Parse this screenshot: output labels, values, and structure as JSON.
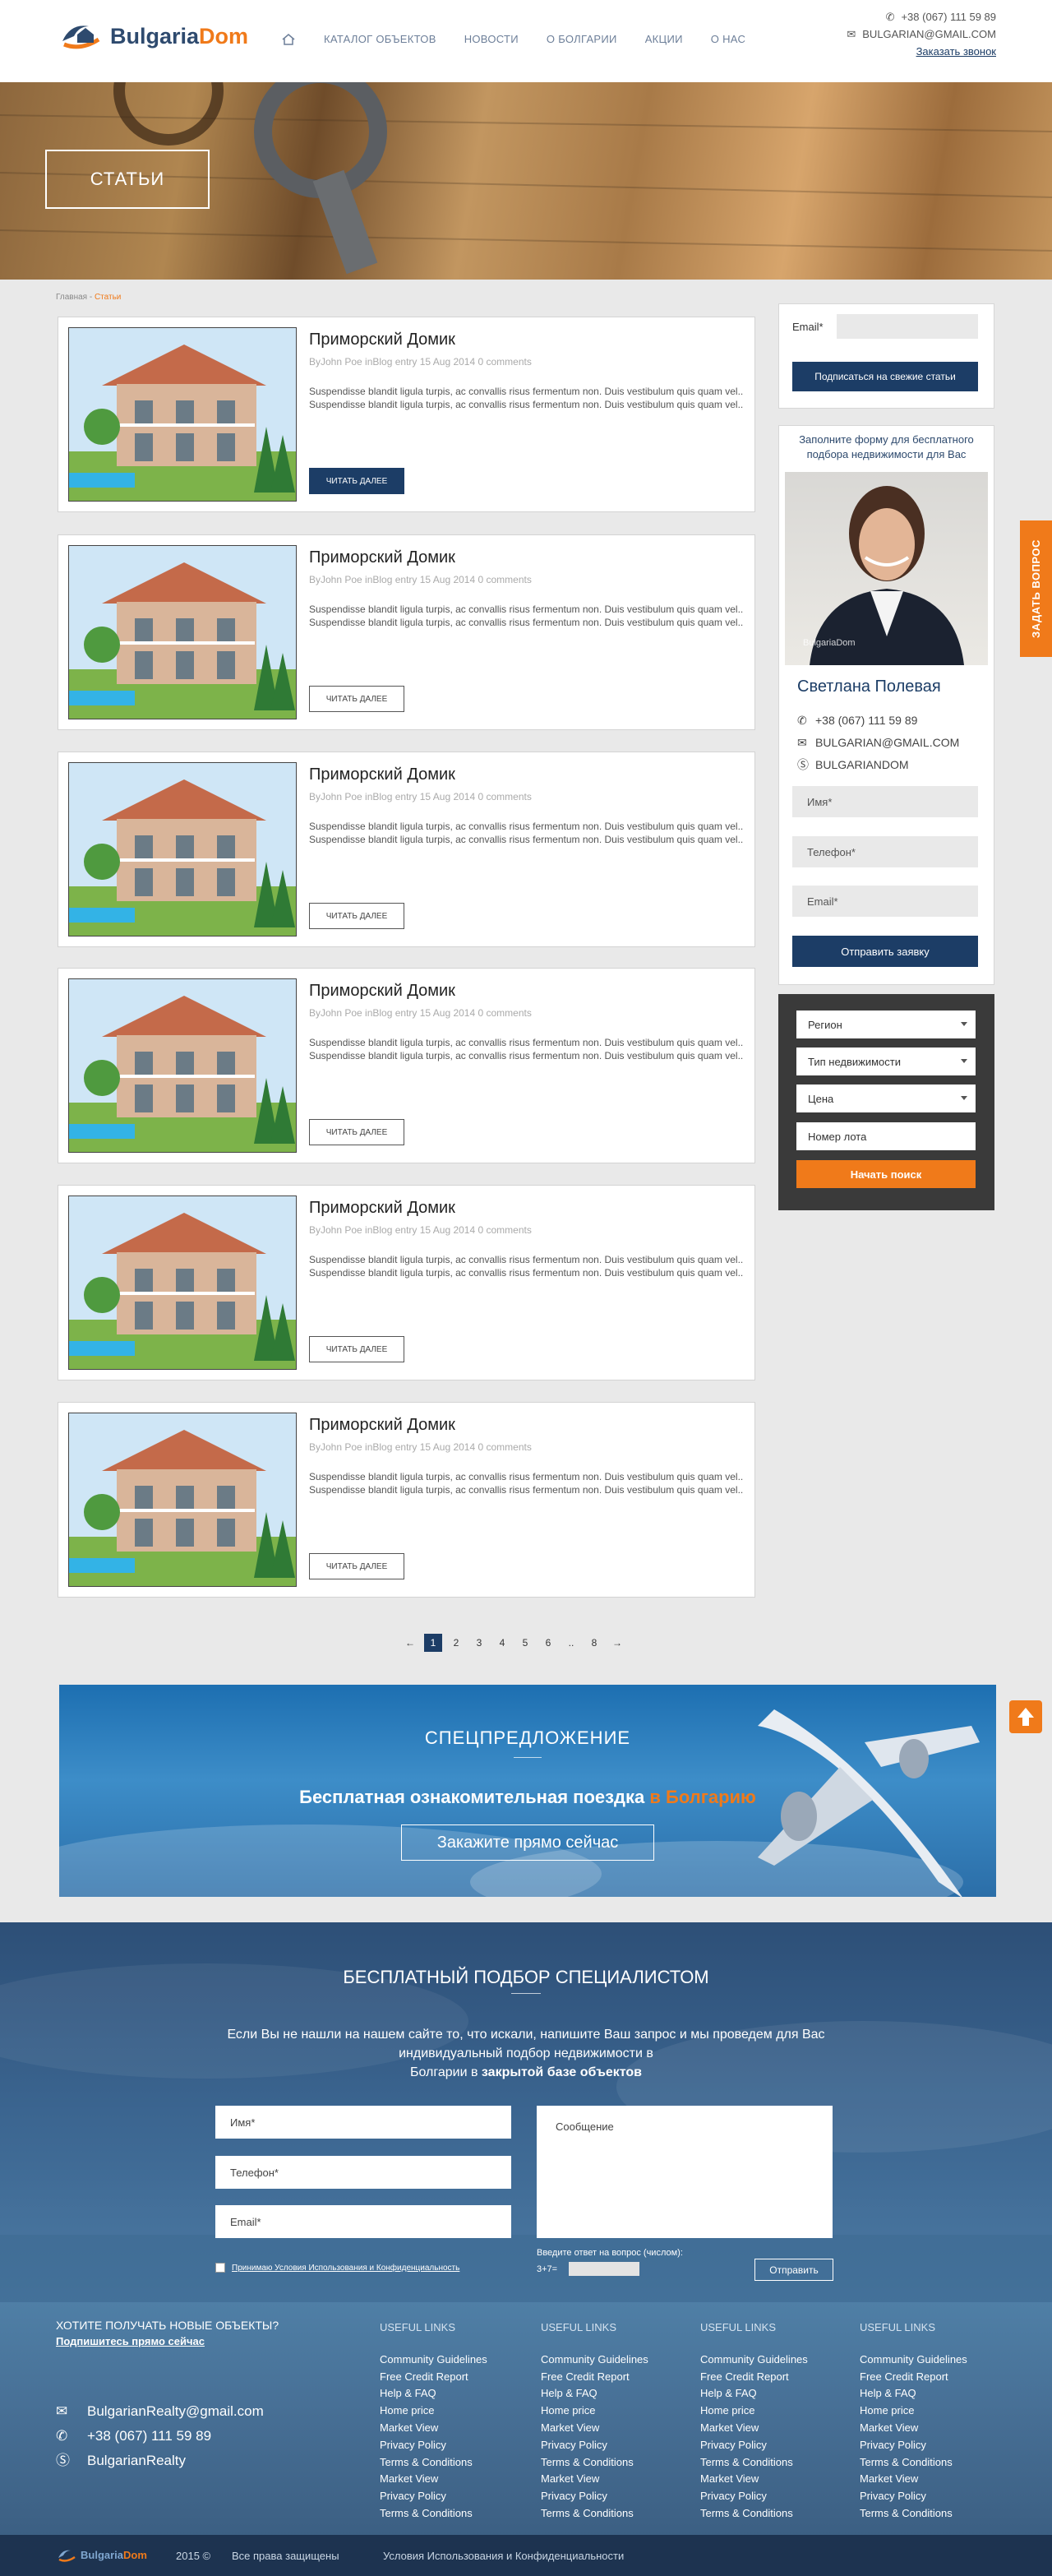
{
  "header": {
    "logo_bulgaria": "Bulgaria",
    "logo_dom": "Dom",
    "nav": [
      "КАТАЛОГ ОБЪЕКТОВ",
      "НОВОСТИ",
      "О БОЛГАРИИ",
      "АКЦИИ",
      "О НАС"
    ],
    "phone": "+38 (067) 111 59 89",
    "email": "BULGARIAN@GMAIL.COM",
    "callback": "Заказать звонок"
  },
  "hero": {
    "title": "СТАТЬИ"
  },
  "breadcrumb": {
    "home": "Главная",
    "sep": " - ",
    "current": "Статьи"
  },
  "posts": [
    {
      "title": "Приморский Домик",
      "meta": "ByJohn Poe inBlog entry 15 Aug 2014 0 comments",
      "excerpt": "Suspendisse blandit ligula turpis, ac convallis risus fermentum non. Duis vestibulum quis quam vel.. Suspendisse blandit ligula turpis, ac convallis risus fermentum non. Duis vestibulum quis quam vel..",
      "more": "ЧИТАТЬ ДАЛЕЕ"
    },
    {
      "title": "Приморский Домик",
      "meta": "ByJohn Poe inBlog entry 15 Aug 2014 0 comments",
      "excerpt": "Suspendisse blandit ligula turpis, ac convallis risus fermentum non. Duis vestibulum quis quam vel.. Suspendisse blandit ligula turpis, ac convallis risus fermentum non. Duis vestibulum quis quam vel..",
      "more": "ЧИТАТЬ ДАЛЕЕ"
    },
    {
      "title": "Приморский Домик",
      "meta": "ByJohn Poe inBlog entry 15 Aug 2014 0 comments",
      "excerpt": "Suspendisse blandit ligula turpis, ac convallis risus fermentum non. Duis vestibulum quis quam vel.. Suspendisse blandit ligula turpis, ac convallis risus fermentum non. Duis vestibulum quis quam vel..",
      "more": "ЧИТАТЬ ДАЛЕЕ"
    },
    {
      "title": "Приморский Домик",
      "meta": "ByJohn Poe inBlog entry 15 Aug 2014 0 comments",
      "excerpt": "Suspendisse blandit ligula turpis, ac convallis risus fermentum non. Duis vestibulum quis quam vel.. Suspendisse blandit ligula turpis, ac convallis risus fermentum non. Duis vestibulum quis quam vel..",
      "more": "ЧИТАТЬ ДАЛЕЕ"
    },
    {
      "title": "Приморский Домик",
      "meta": "ByJohn Poe inBlog entry 15 Aug 2014 0 comments",
      "excerpt": "Suspendisse blandit ligula turpis, ac convallis risus fermentum non. Duis vestibulum quis quam vel.. Suspendisse blandit ligula turpis, ac convallis risus fermentum non. Duis vestibulum quis quam vel..",
      "more": "ЧИТАТЬ ДАЛЕЕ"
    },
    {
      "title": "Приморский Домик",
      "meta": "ByJohn Poe inBlog entry 15 Aug 2014 0 comments",
      "excerpt": "Suspendisse blandit ligula turpis, ac convallis risus fermentum non. Duis vestibulum quis quam vel.. Suspendisse blandit ligula turpis, ac convallis risus fermentum non. Duis vestibulum quis quam vel..",
      "more": "ЧИТАТЬ ДАЛЕЕ"
    }
  ],
  "pagination": {
    "prev": "←",
    "pages": [
      "1",
      "2",
      "3",
      "4",
      "5",
      "6",
      "..",
      "8"
    ],
    "next": "→",
    "active": "1"
  },
  "subscribe": {
    "email_label": "Email*",
    "button": "Подписаться на свежие статьи"
  },
  "agent": {
    "intro": "Заполните форму для бесплатного подбора недвижимости для Вас",
    "photo_watermark": "BulgariaDom",
    "name": "Светлана Полевая",
    "phone": "+38 (067) 111 59 89",
    "email": "BULGARIAN@GMAIL.COM",
    "skype": "BULGARIANDOM",
    "name_placeholder": "Имя*",
    "phone_placeholder": "Телефон*",
    "email_placeholder": "Email*",
    "submit": "Отправить заявку"
  },
  "search": {
    "region": "Регион",
    "type": "Тип недвижимости",
    "price": "Цена",
    "lot": "Номер лота",
    "submit": "Начать поиск"
  },
  "ask_tab": "ЗАДАТЬ ВОПРОС",
  "offer": {
    "heading": "СПЕЦПРЕДЛОЖЕНИЕ",
    "text_main": "Бесплатная ознакомительная поездка ",
    "text_accent": "в Болгарию",
    "button": "Закажите прямо сейчас"
  },
  "selection": {
    "heading": "БЕСПЛАТНЫЙ ПОДБОР СПЕЦИАЛИСТОМ",
    "text_1": "Если Вы не нашли на нашем сайте то, что искали, напишите Ваш запрос и мы проведем для Вас индивидуальный подбор недвижимости в",
    "text_2": "Болгарии в ",
    "text_bold": "закрытой базе объектов",
    "name_placeholder": "Имя*",
    "phone_placeholder": "Телефон*",
    "email_placeholder": "Email*",
    "message_placeholder": "Сообщение",
    "captcha_label": "Введите ответ на вопрос (числом):",
    "captcha_question": "3+7=",
    "terms": "Принимаю Условия Использования и Конфиденциальность",
    "submit": "Отправить"
  },
  "footer": {
    "newsletter_title": "ХОТИТЕ ПОЛУЧАТЬ НОВЫЕ ОБЪЕКТЫ?",
    "newsletter_link": "Подпишитесь прямо сейчас",
    "email": "BulgarianRealty@gmail.com",
    "phone": "+38 (067) 111 59 89",
    "skype": "BulgarianRealty",
    "columns": [
      {
        "title": "USEFUL LINKS",
        "links": [
          "Community Guidelines",
          "Free Credit Report",
          "Help & FAQ",
          "Home price",
          "Market View",
          "Privacy Policy",
          "Terms & Conditions",
          "Market View",
          "Privacy Policy",
          "Terms & Conditions"
        ]
      },
      {
        "title": "USEFUL LINKS",
        "links": [
          "Community Guidelines",
          "Free Credit Report",
          "Help & FAQ",
          "Home price",
          "Market View",
          "Privacy Policy",
          "Terms & Conditions",
          "Market View",
          "Privacy Policy",
          "Terms & Conditions"
        ]
      },
      {
        "title": "USEFUL LINKS",
        "links": [
          "Community Guidelines",
          "Free Credit Report",
          "Help & FAQ",
          "Home price",
          "Market View",
          "Privacy Policy",
          "Terms & Conditions",
          "Market View",
          "Privacy Policy",
          "Terms & Conditions"
        ]
      },
      {
        "title": "USEFUL LINKS",
        "links": [
          "Community Guidelines",
          "Free Credit Report",
          "Help & FAQ",
          "Home price",
          "Market View",
          "Privacy Policy",
          "Terms & Conditions",
          "Market View",
          "Privacy Policy",
          "Terms & Conditions"
        ]
      }
    ],
    "bottom_logo_bulgaria": "Bulgaria",
    "bottom_logo_dom": "Dom",
    "copyright": "2015 ©",
    "rights": "Все права защищены",
    "terms": "Условия Использования и Конфиденциальности"
  },
  "colors": {
    "navy": "#1c3d66",
    "orange": "#f07a1a"
  }
}
